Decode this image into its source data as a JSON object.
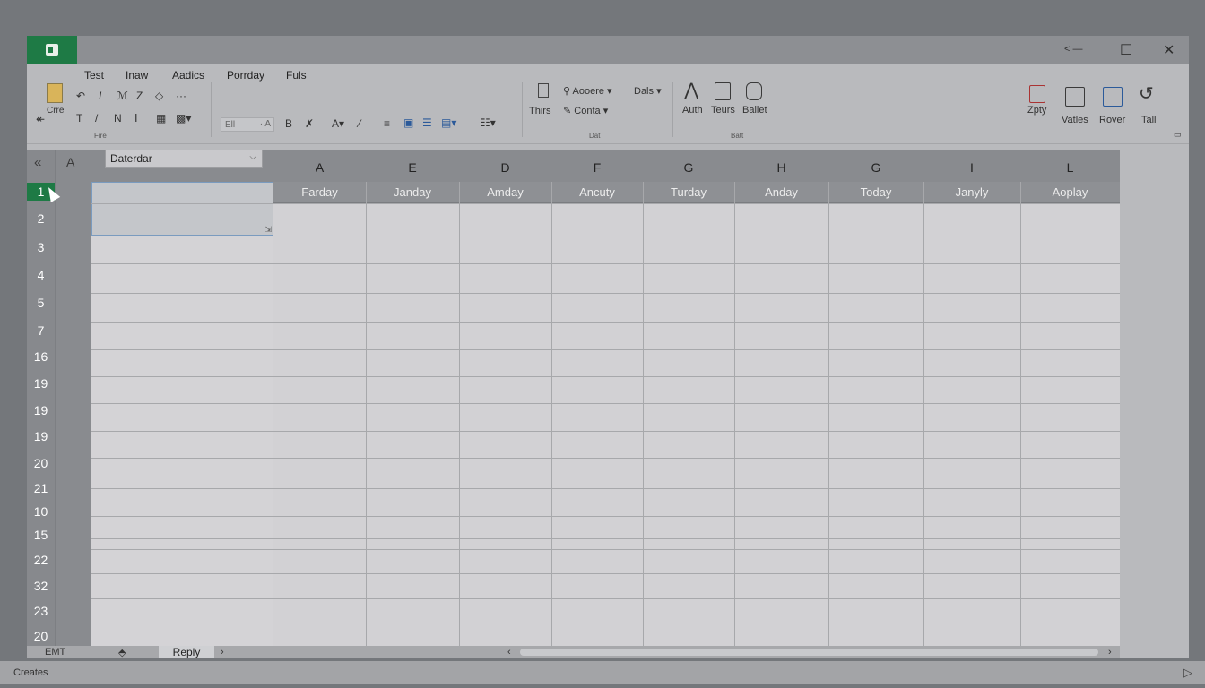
{
  "window": {
    "controls": {
      "restore": "˂ —",
      "maximize": "☐",
      "close": "✕"
    }
  },
  "ribbon": {
    "tabs": [
      "Test",
      "Inaw",
      "Aadics",
      "Porrday",
      "Fuls"
    ],
    "clipboard": {
      "paste_label": "Crre",
      "group_label": "Fire"
    },
    "font": {
      "font_box": "Ell"
    },
    "edit_group": {
      "item1": "Aooere",
      "item2": "Conta",
      "item3": "Dals",
      "left_label": "Thirs",
      "group_label": "Dat"
    },
    "insert_group": {
      "label1": "Auth",
      "label2": "Teurs",
      "label3": "Ballet",
      "group_label": "Batt"
    },
    "right_group": {
      "label1": "Zpty",
      "label2": "Vatles",
      "label3": "Rover",
      "label4": "Tall"
    }
  },
  "grid": {
    "name_box": "Daterdar",
    "column_letters": [
      "A",
      "E",
      "D",
      "F",
      "G",
      "H",
      "G",
      "I",
      "L"
    ],
    "header_row": [
      "Farday",
      "Janday",
      "Amday",
      "Ancuty",
      "Turday",
      "Anday",
      "Today",
      "Janyly",
      "Aoplay"
    ],
    "row_numbers": [
      "1",
      "2",
      "3",
      "4",
      "5",
      "7",
      "16",
      "19",
      "19",
      "19",
      "20",
      "21",
      "10",
      "15",
      "22",
      "32",
      "23",
      "20"
    ]
  },
  "sheet_tabs": {
    "left_label": "EMT",
    "active_tab": "Reply"
  },
  "status": {
    "text": "Creates"
  },
  "colors": {
    "accent": "#1e7a45",
    "selection_border": "#7a9bbf"
  }
}
